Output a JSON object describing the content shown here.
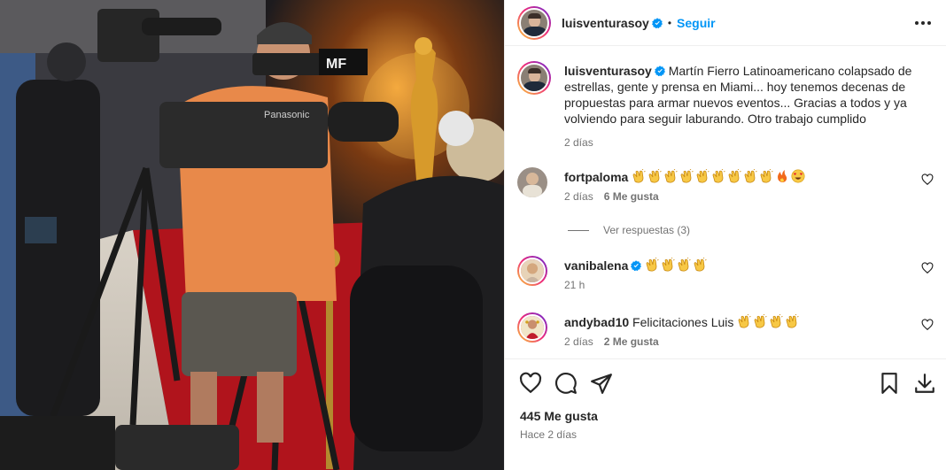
{
  "post": {
    "username": "luisventurasoy",
    "follow_label": "Seguir",
    "separator": "•"
  },
  "caption": {
    "username": "luisventurasoy",
    "text": "Martín Fierro Latinoamericano colapsado de estrellas, gente y prensa en Miami... hoy tenemos decenas de propuestas para armar nuevos eventos... Gracias a todos y ya volviendo para seguir laburando. Otro trabajo cumplido",
    "time": "2 días"
  },
  "comments": [
    {
      "username": "fortpaloma",
      "text": "",
      "emojis": [
        "clap",
        "clap",
        "clap",
        "clap",
        "clap",
        "clap",
        "clap",
        "clap",
        "clap",
        "fire",
        "heart-eyes"
      ],
      "time": "2 días",
      "likes": "6 Me gusta"
    },
    {
      "username": "vanibalena",
      "verified": true,
      "text": "",
      "emojis": [
        "clap",
        "clap",
        "clap",
        "clap"
      ],
      "time": "21 h",
      "likes": ""
    },
    {
      "username": "andybad10",
      "text": "Felicitaciones Luis",
      "emojis": [
        "clap",
        "clap",
        "clap",
        "clap"
      ],
      "time": "2 días",
      "likes": "2 Me gusta"
    }
  ],
  "view_replies": "Ver respuestas (3)",
  "actions": {
    "likes": "445 Me gusta",
    "ago": "Hace 2 días",
    "icons": [
      "heart-icon",
      "comment-icon",
      "share-icon",
      "bookmark-icon",
      "download-icon"
    ]
  },
  "photo": {
    "camera_logo": "Panasonic",
    "backdrop_text": "MF"
  },
  "colors": {
    "accent": "#0095f6",
    "verified": "#0095f6",
    "text": "#262626",
    "muted": "#737373",
    "red_carpet": "#b0141c",
    "shirt": "#e8894a"
  }
}
